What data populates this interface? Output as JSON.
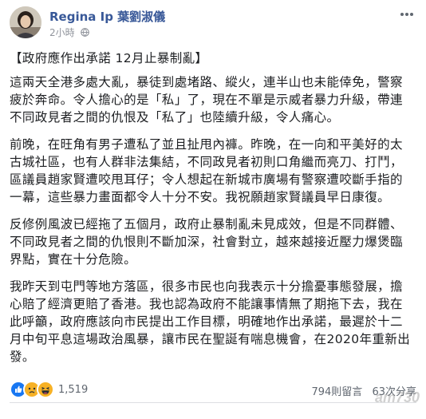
{
  "post": {
    "author": "Regina Ip 葉劉淑儀",
    "timestamp": "2小時",
    "globe_icon": "globe-icon",
    "title": "【政府應作出承諾 12月止暴制亂】",
    "paragraphs": [
      "這兩天全港多處大亂，暴徒到處堵路、縱火，連半山也未能倖免，警察疲於奔命。令人擔心的是「私」了，現在不單是示威者暴力升級，帶連不同政見者之間的仇恨及「私了」也陸續升級，令人痛心。",
      "前晚，在旺角有男子遭私了並且扯甩內褲。昨晚，在一向和平美好的太古城社區，也有人群非法集結，不同政見者初則口角繼而亮刀、打鬥，區議員趙家賢遭咬甩耳仔；令人想起在新城市廣場有警察遭咬斷手指的一幕，這些暴力畫面都令人十分不安。我祝願趙家賢議員早日康復。",
      "反修例風波已經拖了五個月，政府止暴制亂未見成效，但是不同群體、不同政見者之間的仇恨則不斷加深，社會對立，越來越接近壓力爆煲臨界點，實在十分危險。",
      "我昨天到屯門等地方落區，很多市民也向我表示十分擔憂事態發展，擔心賠了經濟更賠了香港。我也認為政府不能讓事情無了期拖下去，我在此呼籲，政府應該向市民提出工作目標，明確地作出承諾，最遲於十二月中旬平息這場政治風暴，讓市民在聖誕有喘息機會，在2020年重新出發。"
    ],
    "reactions_count": "1,519",
    "comments_count": "794則留言",
    "shares_count": "63次分享"
  },
  "watermark": "am730",
  "colors": {
    "author": "#385898",
    "meta": "#90949c",
    "like": "#1877f2",
    "haha": "#f7b125"
  }
}
